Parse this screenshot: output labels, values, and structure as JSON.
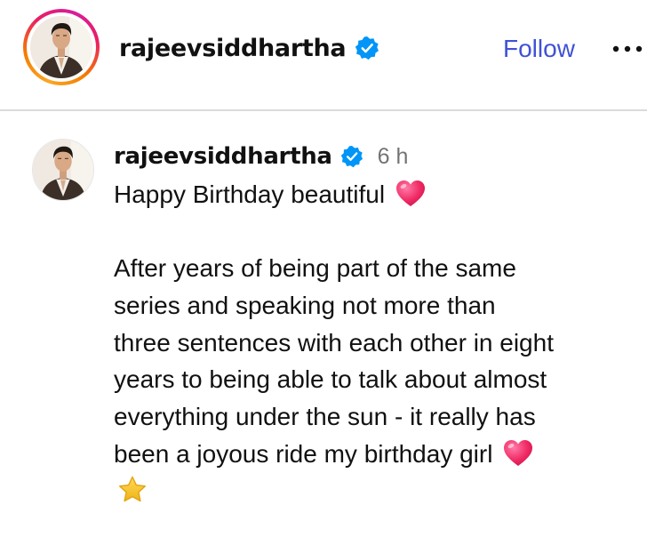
{
  "header": {
    "username": "rajeevsiddhartha",
    "follow_label": "Follow",
    "more_label": "•••"
  },
  "comment": {
    "username": "rajeevsiddhartha",
    "time": "6 h",
    "lines": [
      "Happy Birthday beautiful",
      "After years of being part of the same",
      "series and speaking not more than",
      "three sentences with each other in eight",
      "years to being able to talk about almost",
      "everything under the sun - it really has",
      "been a joyous ride my birthday girl"
    ]
  },
  "colors": {
    "follow": "#3f51d6",
    "verified": "#0095f6",
    "divider": "#dbdbdb",
    "timestamp": "#737373",
    "heart": "#f02a64",
    "star": "#f6c324"
  },
  "icons": {
    "verified": "verified-badge-icon",
    "more": "more-options-icon",
    "heart": "pink-heart-emoji",
    "star": "star-emoji"
  }
}
